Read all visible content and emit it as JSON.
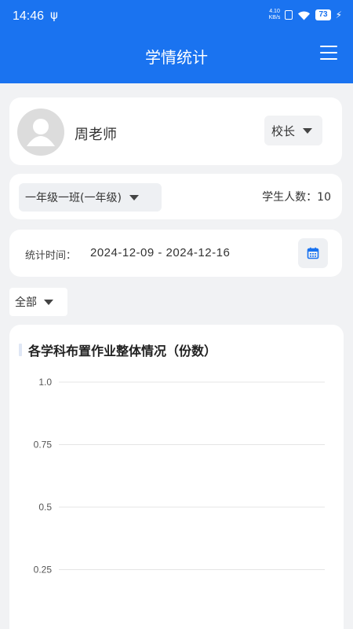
{
  "status_bar": {
    "time": "14:46",
    "net_speed_value": "4.10",
    "net_speed_unit": "KB/s",
    "battery": "73"
  },
  "app_bar": {
    "title": "学情统计"
  },
  "teacher": {
    "name": "周老师",
    "role": "校长"
  },
  "class_info": {
    "class_name": "一年级一班(一年级)",
    "student_count_label": "学生人数：",
    "student_count": "10"
  },
  "time_filter": {
    "label": "统计时间：",
    "range": "2024-12-09 - 2024-12-16"
  },
  "subject_filter": {
    "selected": "全部"
  },
  "chart_data": {
    "type": "bar",
    "title": "各学科布置作业整体情况（份数）",
    "xlabel": "",
    "ylabel": "",
    "categories": [],
    "values": [],
    "y_ticks": [
      "1.0",
      "0.75",
      "0.5",
      "0.25"
    ],
    "y_tick_values": [
      1.0,
      0.75,
      0.5,
      0.25
    ],
    "ylim": [
      0,
      1.0
    ],
    "grid": true
  },
  "colors": {
    "primary": "#1a73f0",
    "background": "#f1f2f4",
    "card": "#ffffff",
    "grid": "#e5e5e5"
  }
}
